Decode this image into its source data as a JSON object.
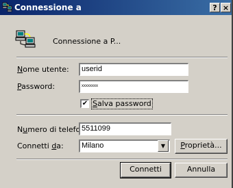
{
  "titlebar": {
    "title": "Connessione a",
    "help_label": "?",
    "close_label": "×"
  },
  "heading": "Connessione a P...",
  "form": {
    "username": {
      "label_prefix": "",
      "label_accel": "N",
      "label_rest": "ome utente:",
      "value": "userid"
    },
    "password": {
      "label_prefix": "",
      "label_accel": "P",
      "label_rest": "assword:",
      "value": "xxxxxxxx"
    },
    "save_password": {
      "label_prefix": "",
      "label_accel": "S",
      "label_rest": "alva password",
      "checked": true,
      "check_glyph": "✔"
    },
    "phone": {
      "label_prefix": "N",
      "label_accel": "u",
      "label_rest": "mero di telefono:",
      "value": "5511099"
    },
    "dial_from": {
      "label_prefix": "Connetti ",
      "label_accel": "d",
      "label_rest": "a:",
      "value": "Milano",
      "arrow": "▼"
    }
  },
  "buttons": {
    "properties": {
      "prefix": "",
      "accel": "P",
      "rest": "roprietà..."
    },
    "connect": "Connetti",
    "cancel": "Annulla"
  },
  "icons": {
    "title": "dial-up-computers-icon",
    "main": "dial-up-computers-icon"
  }
}
